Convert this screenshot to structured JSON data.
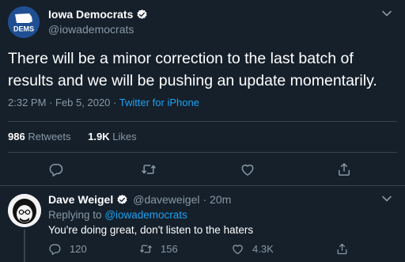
{
  "tweet": {
    "display_name": "Iowa Democrats",
    "handle": "@iowademocrats",
    "avatar_text": "DEMS",
    "text": "There will be a minor correction to the last batch of results and we will be pushing an update momentarily.",
    "time": "2:32 PM",
    "date": "Feb 5, 2020",
    "separator": "·",
    "source": "Twitter for iPhone",
    "retweets_count": "986",
    "retweets_label": "Retweets",
    "likes_count": "1.9K",
    "likes_label": "Likes"
  },
  "actions": {
    "icons": [
      "reply-icon",
      "retweet-icon",
      "like-icon",
      "share-icon"
    ]
  },
  "reply": {
    "display_name": "Dave Weigel",
    "handle": "@daveweigel",
    "age": "· 20m",
    "replying_prefix": "Replying to",
    "replying_to": "@iowademocrats",
    "text": "You're doing great, don't listen to the haters",
    "reply_count": "120",
    "retweet_count": "156",
    "like_count": "4.3K"
  },
  "colors": {
    "background": "#15202b",
    "accent": "#1da1f2",
    "secondary_text": "#8899a6",
    "divider": "#38444d"
  }
}
